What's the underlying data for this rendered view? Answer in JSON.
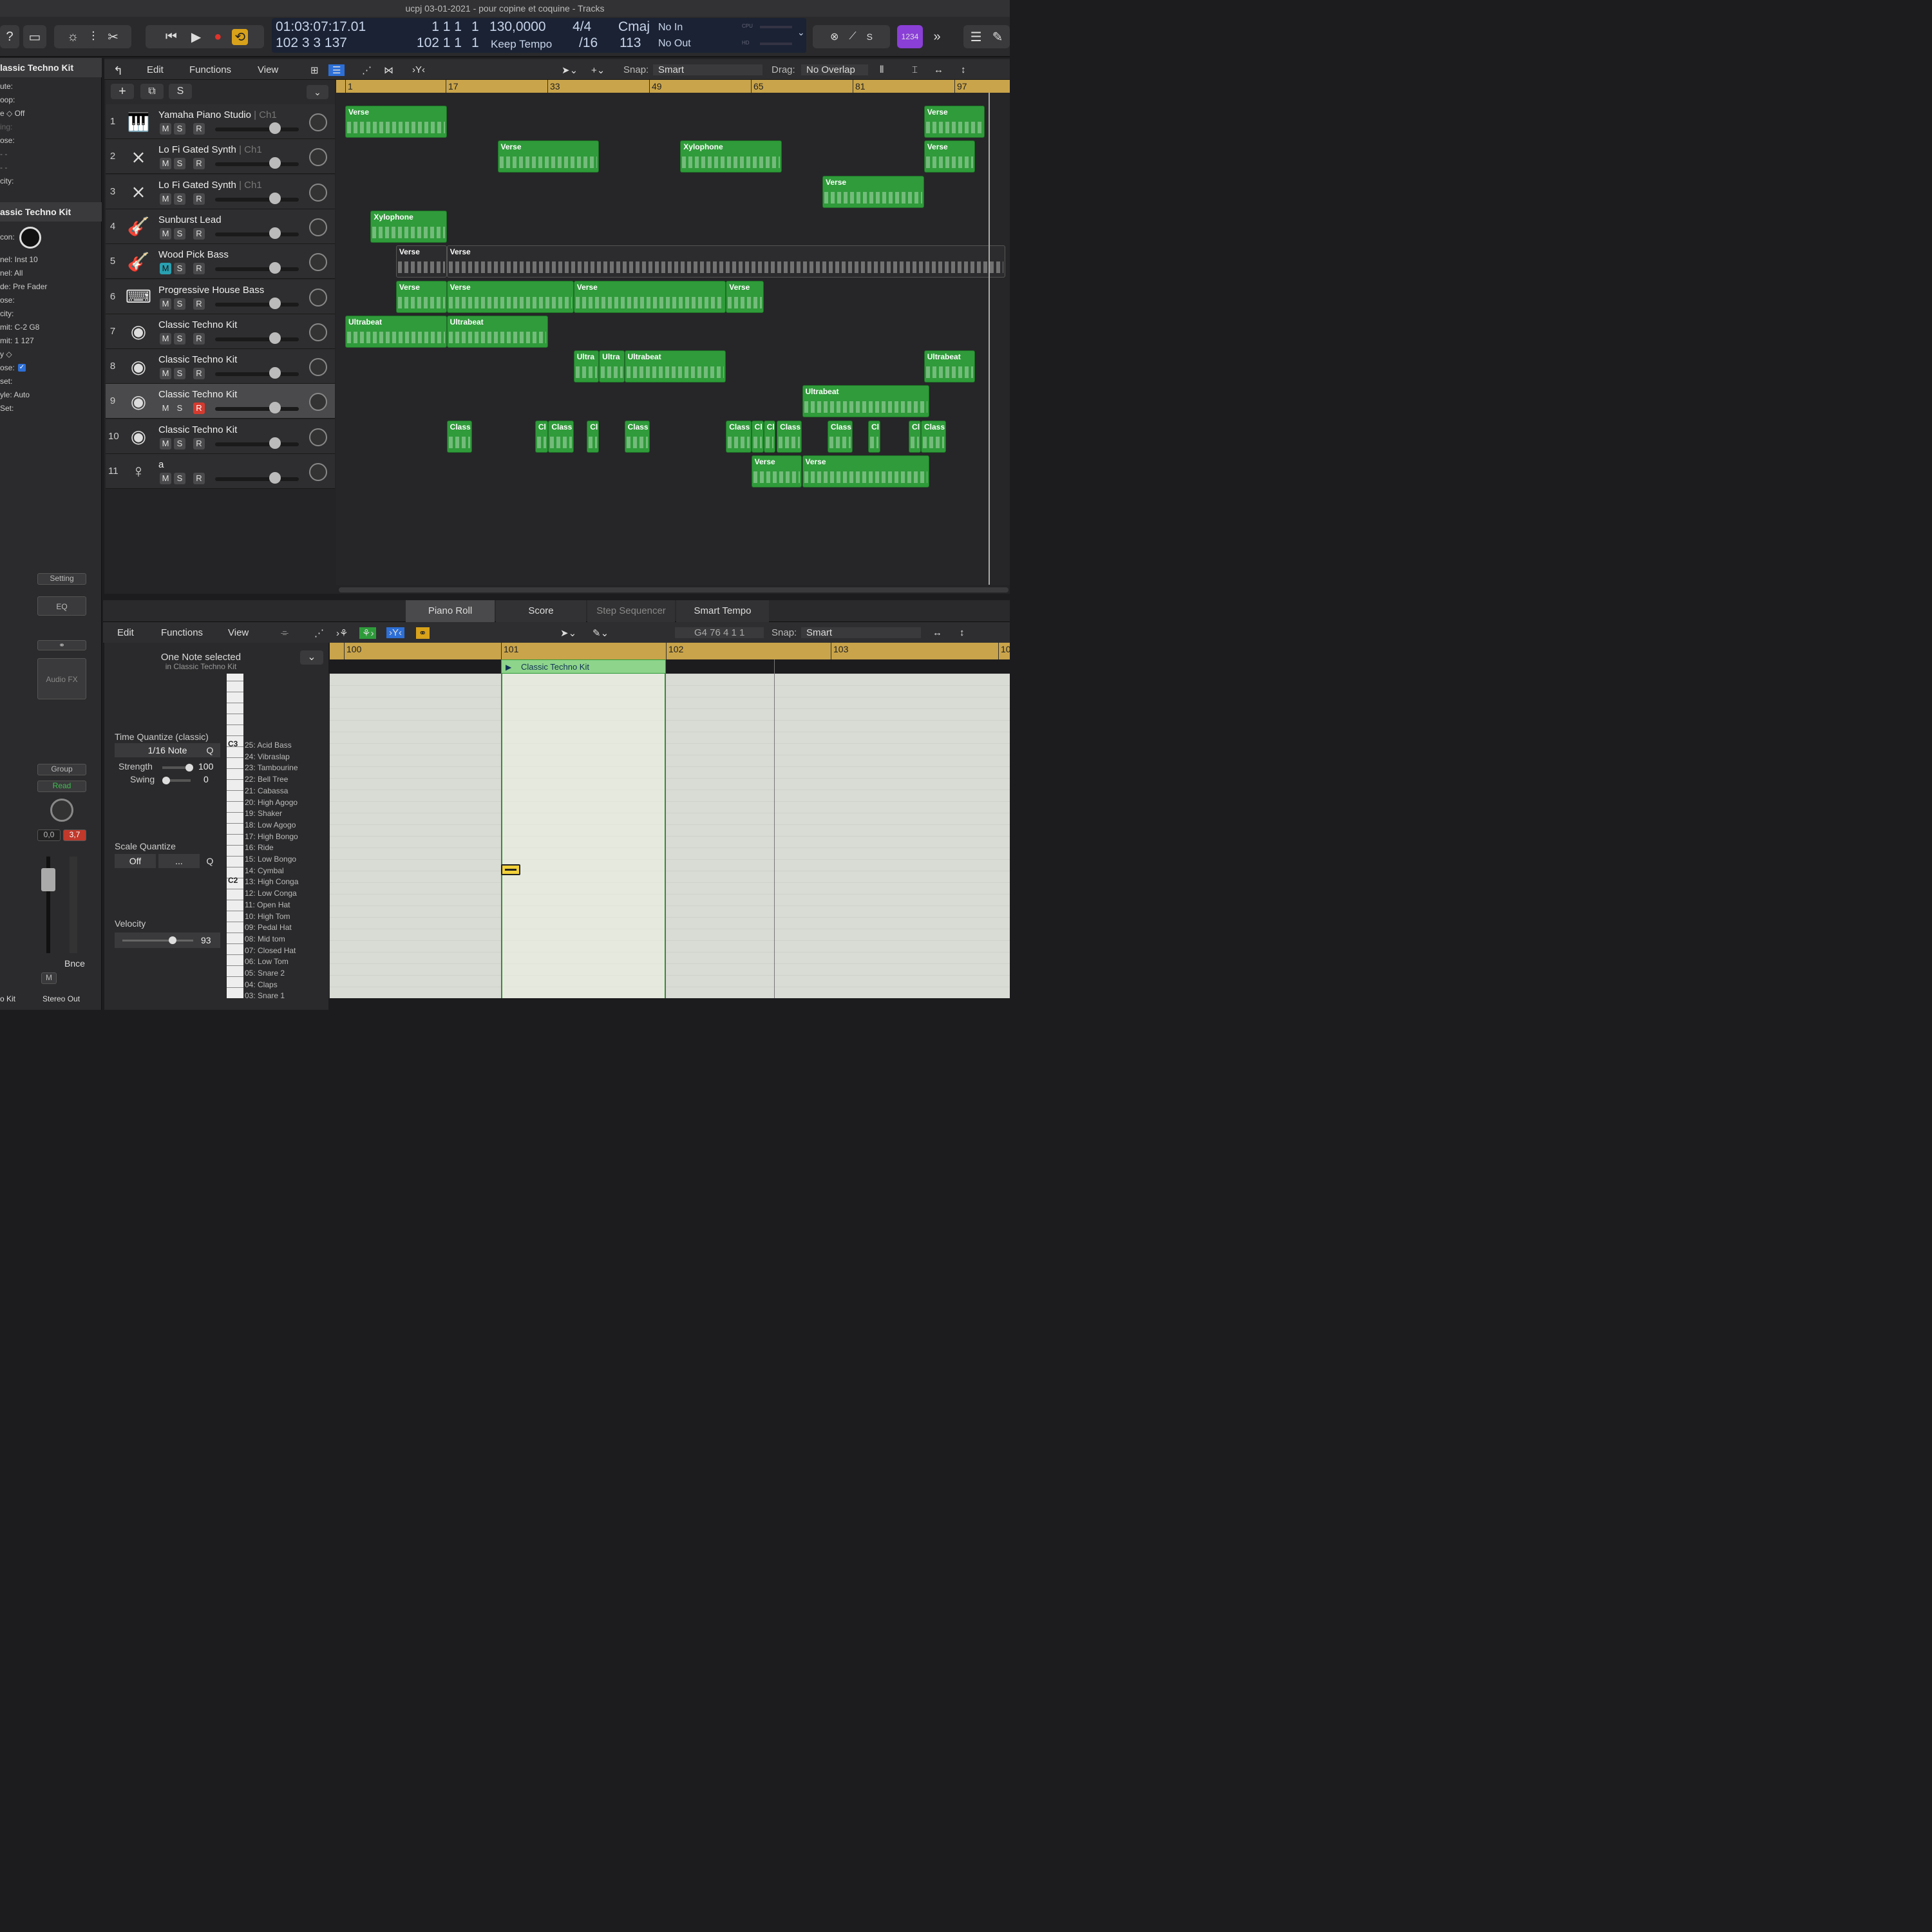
{
  "window_title": "ucpj 03-01-2021 - pour copine et coquine - Tracks",
  "lcd": {
    "time": "01:03:07:17.01",
    "bars": "102  3  3  137",
    "pos1": "1  1  1",
    "pos1b": "1",
    "pos2": "102  1  1",
    "pos2b": "1",
    "tempo": "130,0000",
    "tempo_mode": "Keep Tempo",
    "sig_top": "4/4",
    "sig_bottom": "/16",
    "key": "Cmaj",
    "key_num": "113",
    "in": "No In",
    "out": "No Out",
    "cpu": "CPU",
    "hd": "HD",
    "count": "1234"
  },
  "tracks_menu": {
    "edit": "Edit",
    "functions": "Functions",
    "view": "View",
    "snap_label": "Snap:",
    "snap_value": "Smart",
    "drag_label": "Drag:",
    "drag_value": "No Overlap"
  },
  "ruler_bars": [
    "1",
    "17",
    "33",
    "49",
    "65",
    "81",
    "97"
  ],
  "inspector": {
    "region_title": "lassic Techno Kit",
    "rows1": [
      "ute:",
      "oop:",
      "e ◇ Off",
      "ing:",
      "ose:",
      "- -",
      "- -",
      "city:"
    ],
    "track_title": "assic Techno Kit",
    "icon_label": "con:",
    "rows2": [
      "nel: Inst 10",
      "nel: All",
      "de: Pre Fader",
      "ose:",
      "city:",
      "mit: C-2  G8",
      "mit: 1  127",
      "y ◇",
      "ose:",
      "set:",
      "yle: Auto",
      "Set:"
    ]
  },
  "tracks": [
    {
      "num": "1",
      "name": "Yamaha Piano Studio",
      "ch": "Ch1",
      "icon": "piano-icon",
      "m": "M",
      "s": "S",
      "r": "R"
    },
    {
      "num": "2",
      "name": "Lo Fi Gated Synth",
      "ch": "Ch1",
      "icon": "keyboard-stand-icon",
      "m": "M",
      "s": "S",
      "r": "R"
    },
    {
      "num": "3",
      "name": "Lo Fi Gated Synth",
      "ch": "Ch1",
      "icon": "keyboard-stand-icon",
      "m": "M",
      "s": "S",
      "r": "R"
    },
    {
      "num": "4",
      "name": "Sunburst Lead",
      "ch": "",
      "icon": "guitar-icon",
      "m": "M",
      "s": "S",
      "r": "R"
    },
    {
      "num": "5",
      "name": "Wood Pick Bass",
      "ch": "",
      "icon": "bass-icon",
      "m": "M",
      "s": "S",
      "r": "R"
    },
    {
      "num": "6",
      "name": "Progressive House Bass",
      "ch": "",
      "icon": "synth-icon",
      "m": "M",
      "s": "S",
      "r": "R"
    },
    {
      "num": "7",
      "name": "Classic Techno Kit",
      "ch": "",
      "icon": "drum-machine-icon",
      "m": "M",
      "s": "S",
      "r": "R"
    },
    {
      "num": "8",
      "name": "Classic Techno Kit",
      "ch": "",
      "icon": "drum-machine-icon",
      "m": "M",
      "s": "S",
      "r": "R"
    },
    {
      "num": "9",
      "name": "Classic Techno Kit",
      "ch": "",
      "icon": "drum-machine-icon",
      "m": "M",
      "s": "S",
      "r": "R"
    },
    {
      "num": "10",
      "name": "Classic Techno Kit",
      "ch": "",
      "icon": "drum-machine-icon",
      "m": "M",
      "s": "S",
      "r": "R"
    },
    {
      "num": "11",
      "name": "a",
      "ch": "",
      "icon": "vocal-icon",
      "m": "M",
      "s": "S",
      "r": "R"
    }
  ],
  "regions": [
    {
      "track": 0,
      "start": 1,
      "len": 10,
      "label": "Verse"
    },
    {
      "track": 0,
      "start": 58,
      "len": 6,
      "label": "Verse"
    },
    {
      "track": 1,
      "start": 16,
      "len": 10,
      "label": "Verse"
    },
    {
      "track": 1,
      "start": 34,
      "len": 10,
      "label": "Xylophone"
    },
    {
      "track": 1,
      "start": 58,
      "len": 5,
      "label": "Verse"
    },
    {
      "track": 2,
      "start": 48,
      "len": 10,
      "label": "Verse"
    },
    {
      "track": 3,
      "start": 3.5,
      "len": 7.5,
      "label": "Xylophone"
    },
    {
      "track": 4,
      "start": 6,
      "len": 5,
      "label": "Verse",
      "gray": true
    },
    {
      "track": 4,
      "start": 11,
      "len": 55,
      "label": "Verse",
      "gray": true
    },
    {
      "track": 5,
      "start": 6,
      "len": 5,
      "label": "Verse"
    },
    {
      "track": 5,
      "start": 11,
      "len": 12.5,
      "label": "Verse"
    },
    {
      "track": 5,
      "start": 23.5,
      "len": 15,
      "label": "Verse"
    },
    {
      "track": 5,
      "start": 38.5,
      "len": 3.7,
      "label": "Verse"
    },
    {
      "track": 6,
      "start": 1,
      "len": 10,
      "label": "Ultrabeat"
    },
    {
      "track": 6,
      "start": 11,
      "len": 10,
      "label": "Ultrabeat"
    },
    {
      "track": 7,
      "start": 23.5,
      "len": 2.5,
      "label": "Ultra"
    },
    {
      "track": 7,
      "start": 26,
      "len": 2.5,
      "label": "Ultra"
    },
    {
      "track": 7,
      "start": 28.5,
      "len": 10,
      "label": "Ultrabeat"
    },
    {
      "track": 7,
      "start": 58,
      "len": 5,
      "label": "Ultrabeat"
    },
    {
      "track": 8,
      "start": 46,
      "len": 12.5,
      "label": "Ultrabeat"
    },
    {
      "track": 9,
      "start": 11,
      "len": 2.5,
      "label": "Class"
    },
    {
      "track": 9,
      "start": 19.7,
      "len": 1.3,
      "label": "Cl"
    },
    {
      "track": 9,
      "start": 21,
      "len": 2.5,
      "label": "Class"
    },
    {
      "track": 9,
      "start": 24.8,
      "len": 1.2,
      "label": "Cl"
    },
    {
      "track": 9,
      "start": 28.5,
      "len": 2.5,
      "label": "Class"
    },
    {
      "track": 9,
      "start": 38.5,
      "len": 2.5,
      "label": "Class"
    },
    {
      "track": 9,
      "start": 41,
      "len": 1.2,
      "label": "Cl"
    },
    {
      "track": 9,
      "start": 42.2,
      "len": 1.2,
      "label": "Cl"
    },
    {
      "track": 9,
      "start": 43.5,
      "len": 2.5,
      "label": "Class"
    },
    {
      "track": 9,
      "start": 48.5,
      "len": 2.5,
      "label": "Class"
    },
    {
      "track": 9,
      "start": 52.5,
      "len": 1.2,
      "label": "Cl"
    },
    {
      "track": 9,
      "start": 56.5,
      "len": 1.2,
      "label": "Cl"
    },
    {
      "track": 9,
      "start": 57.7,
      "len": 2.5,
      "label": "Class"
    },
    {
      "track": 10,
      "start": 41,
      "len": 5,
      "label": "Verse"
    },
    {
      "track": 10,
      "start": 46,
      "len": 12.5,
      "label": "Verse"
    }
  ],
  "editor_tabs": [
    "Piano Roll",
    "Score",
    "Step Sequencer",
    "Smart Tempo"
  ],
  "pr_menu": {
    "edit": "Edit",
    "functions": "Functions",
    "view": "View",
    "position": "G4  76 4 1 1",
    "snap_label": "Snap:",
    "snap_value": "Smart"
  },
  "pr_info": {
    "selected": "One Note selected",
    "in_region": "in Classic Techno Kit"
  },
  "time_quantize": {
    "title": "Time Quantize (classic)",
    "value": "1/16 Note",
    "q": "Q",
    "strength_label": "Strength",
    "strength": "100",
    "swing_label": "Swing",
    "swing": "0"
  },
  "scale_quantize": {
    "title": "Scale Quantize",
    "value": "Off",
    "value2": "...",
    "q": "Q"
  },
  "velocity": {
    "title": "Velocity",
    "value": "93"
  },
  "pr_ruler": [
    "100",
    "101",
    "102",
    "103",
    "10"
  ],
  "pr_region_name": "Classic Techno Kit",
  "key_labels": {
    "c3": "C3",
    "c2": "C2"
  },
  "drums": [
    "25: Acid Bass",
    "24: Vibraslap",
    "23: Tambourine",
    "22: Bell Tree",
    "21: Cabassa",
    "20: High Agogo",
    "19: Shaker",
    "18: Low Agogo",
    "17: High Bongo",
    "16: Ride",
    "15: Low Bongo",
    "14: Cymbal",
    "13: High Conga",
    "12: Low Conga",
    "11: Open Hat",
    "10: High Tom",
    "09: Pedal Hat",
    "08: Mid tom",
    "07: Closed Hat",
    "06: Low Tom",
    "05: Snare 2",
    "04: Claps",
    "03: Snare 1"
  ],
  "mixer": {
    "setting": "Setting",
    "eq": "EQ",
    "audio_fx": "Audio FX",
    "group": "Group",
    "read": "Read",
    "vol": "0,0",
    "peak": "3,7",
    "bnce": "Bnce",
    "m": "M",
    "strip_left": "o Kit",
    "strip_right": "Stereo Out"
  }
}
